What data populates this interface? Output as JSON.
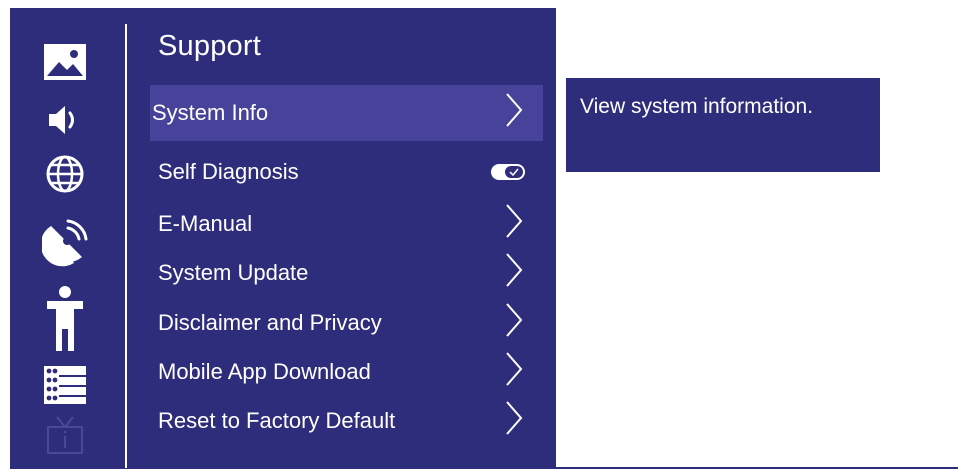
{
  "rail": {
    "icons": [
      "picture-icon",
      "sound-icon",
      "network-icon",
      "broadcast-icon",
      "accessibility-icon",
      "general-icon",
      "support-icon"
    ]
  },
  "menu": {
    "title": "Support",
    "items": [
      {
        "label": "System Info",
        "control": "chevron",
        "selected": true
      },
      {
        "label": "Self Diagnosis",
        "control": "toggle",
        "toggle_on": true
      },
      {
        "label": "E-Manual",
        "control": "chevron"
      },
      {
        "label": "System Update",
        "control": "chevron"
      },
      {
        "label": "Disclaimer and Privacy",
        "control": "chevron"
      },
      {
        "label": "Mobile App Download",
        "control": "chevron"
      },
      {
        "label": "Reset to Factory Default",
        "control": "chevron"
      }
    ]
  },
  "panel": {
    "description": "View system information."
  },
  "colors": {
    "background": "#2e2d7b",
    "selected": "#48439a",
    "text": "#ffffff",
    "disabled_icon": "#4a4994"
  }
}
